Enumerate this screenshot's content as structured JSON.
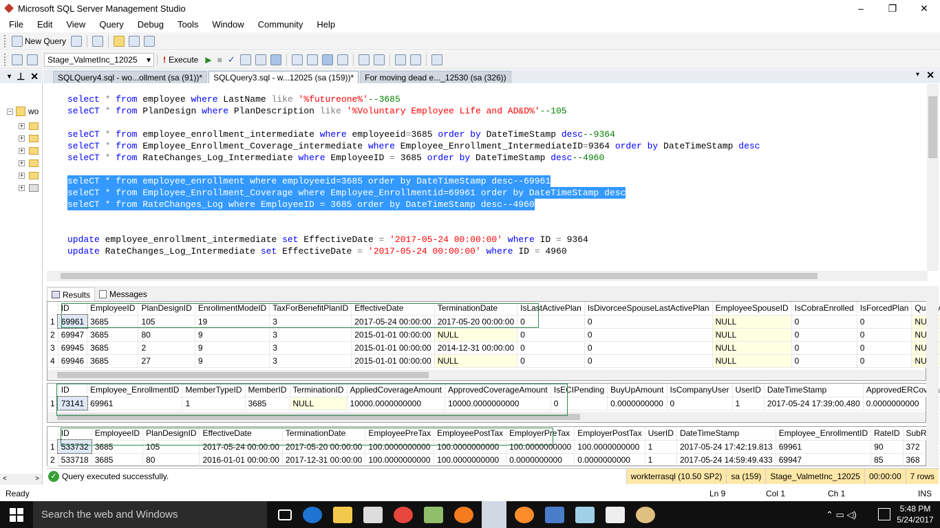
{
  "window": {
    "title": "Microsoft SQL Server Management Studio",
    "controls": [
      "–",
      "❐",
      "✕"
    ]
  },
  "menu": [
    "File",
    "Edit",
    "View",
    "Query",
    "Debug",
    "Tools",
    "Window",
    "Community",
    "Help"
  ],
  "toolbar": {
    "new_query": "New Query",
    "database": "Stage_ValmetInc_12025",
    "execute": "Execute"
  },
  "tabs": [
    {
      "label": "SQLQuery4.sql - wo...ollment (sa (91))*",
      "active": false
    },
    {
      "label": "SQLQuery3.sql - w...12025 (sa (159))*",
      "active": true
    },
    {
      "label": "For moving dead e..._12530 (sa (326))",
      "active": false
    }
  ],
  "left_panel": {
    "server_label": "wo"
  },
  "editor_lines": [
    "select * from employee where LastName like '%futureone%'--3685",
    "seleCT * from PlanDesign where PlanDescription like '%Voluntary Employee Life and AD&D%'--105",
    "",
    "seleCT * from employee_enrollment_intermediate where employeeid=3685 order by DateTimeStamp desc--9364",
    "seleCT * from Employee_Enrollment_Coverage_intermediate where Employee_Enrollment_IntermediateID=9364 order by DateTimeStamp desc",
    "seleCT * from RateChanges_Log_Intermediate where EmployeeID = 3685 order by DateTimeStamp desc--4960",
    "",
    "seleCT * from employee_enrollment where employeeid=3685 order by DateTimeStamp desc--69961",
    "seleCT * from Employee_Enrollment_Coverage where Employee_Enrollmentid=69961 order by DateTimeStamp desc",
    "seleCT * from RateChanges_Log where EmployeeID = 3685 order by DateTimeStamp desc--4960",
    "",
    "",
    "update employee_enrollment_intermediate set EffectiveDate = '2017-05-24 00:00:00' where ID = 9364",
    "update RateChanges_Log_Intermediate set EffectiveDate = '2017-05-24 00:00:00' where ID = 4960"
  ],
  "results_tabs": {
    "results": "Results",
    "messages": "Messages"
  },
  "grid1": {
    "headers": [
      "ID",
      "EmployeeID",
      "PlanDesignID",
      "EnrollmentModeID",
      "TaxForBenefitPlanID",
      "EffectiveDate",
      "TerminationDate",
      "IsLastActivePlan",
      "IsDivorceeSpouseLastActivePlan",
      "EmployeeSpouseID",
      "IsCobraEnrolled",
      "IsForcedPlan",
      "Qualifyin"
    ],
    "rows": [
      [
        "1",
        "69961",
        "3685",
        "105",
        "19",
        "3",
        "2017-05-24 00:00:00",
        "2017-05-20 00:00:00",
        "0",
        "0",
        "NULL",
        "0",
        "0",
        "NULL"
      ],
      [
        "2",
        "69947",
        "3685",
        "80",
        "9",
        "3",
        "2015-01-01 00:00:00",
        "NULL",
        "0",
        "0",
        "NULL",
        "0",
        "0",
        "NULL"
      ],
      [
        "3",
        "69945",
        "3685",
        "2",
        "9",
        "3",
        "2015-01-01 00:00:00",
        "2014-12-31 00:00:00",
        "0",
        "0",
        "NULL",
        "0",
        "0",
        "NULL"
      ],
      [
        "4",
        "69946",
        "3685",
        "27",
        "9",
        "3",
        "2015-01-01 00:00:00",
        "NULL",
        "0",
        "0",
        "NULL",
        "0",
        "0",
        "NULL"
      ]
    ]
  },
  "grid2": {
    "headers": [
      "ID",
      "Employee_EnrollmentID",
      "MemberTypeID",
      "MemberID",
      "TerminationID",
      "AppliedCoverageAmount",
      "ApprovedCoverageAmount",
      "IsECIPending",
      "BuyUpAmount",
      "IsCompanyUser",
      "UserID",
      "DateTimeStamp",
      "ApprovedERCoverag"
    ],
    "rows": [
      [
        "1",
        "73141",
        "69961",
        "1",
        "3685",
        "NULL",
        "10000.0000000000",
        "10000.0000000000",
        "0",
        "0.0000000000",
        "0",
        "1",
        "2017-05-24 17:39:00.480",
        "0.0000000000"
      ]
    ]
  },
  "grid3": {
    "headers": [
      "ID",
      "EmployeeID",
      "PlanDesignID",
      "EffectiveDate",
      "TerminationDate",
      "EmployeePreTax",
      "EmployeePostTax",
      "EmployerPreTax",
      "EmployerPostTax",
      "UserID",
      "DateTimeStamp",
      "Employee_EnrollmentID",
      "RateID",
      "SubRate"
    ],
    "rows": [
      [
        "1",
        "533732",
        "3685",
        "105",
        "2017-05-24 00:00:00",
        "2017-05-20 00:00:00",
        "100.0000000000",
        "100.0000000000",
        "100.0000000000",
        "100.0000000000",
        "1",
        "2017-05-24 17:42:19.813",
        "69961",
        "90",
        "372"
      ],
      [
        "2",
        "533718",
        "3685",
        "80",
        "2016-01-01 00:00:00",
        "2017-12-31 00:00:00",
        "100.0000000000",
        "100.0000000000",
        "0.0000000000",
        "0.0000000000",
        "1",
        "2017-05-24 14:59:49.433",
        "69947",
        "85",
        "368"
      ]
    ]
  },
  "query_status": {
    "message": "Query executed successfully.",
    "server": "workterrasql (10.50 SP2)",
    "user": "sa (159)",
    "db": "Stage_ValmetInc_12025",
    "time": "00:00:00",
    "rows": "7 rows"
  },
  "statusbar": {
    "ready": "Ready",
    "ln": "Ln 9",
    "col": "Col 1",
    "ch": "Ch 1",
    "ins": "INS"
  },
  "taskbar": {
    "search": "Search the web and Windows",
    "time": "5:48 PM",
    "date": "5/24/2017"
  }
}
